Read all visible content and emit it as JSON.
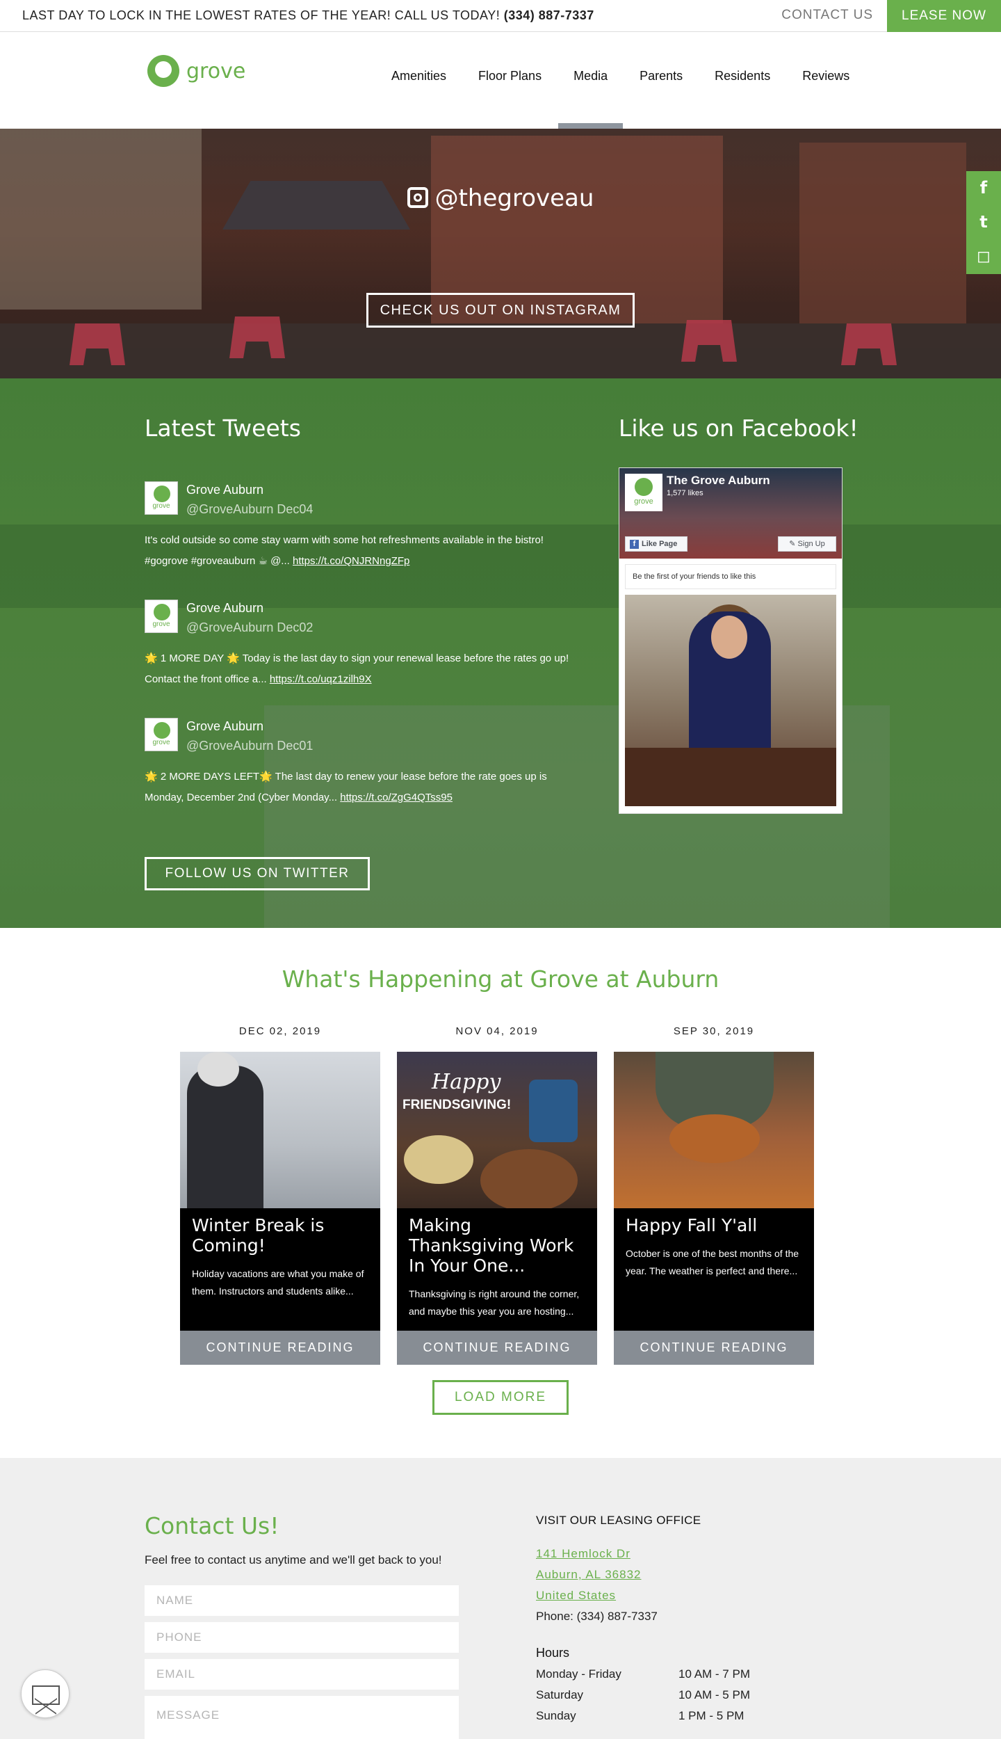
{
  "topbar": {
    "promo": "LAST DAY TO LOCK IN THE LOWEST RATES OF THE YEAR! CALL US TODAY!",
    "phone": "(334) 887-7337",
    "contact_label": "CONTACT US",
    "lease_label": "LEASE NOW"
  },
  "header": {
    "logo_text": "grove",
    "nav": [
      "Amenities",
      "Floor Plans",
      "Media",
      "Parents",
      "Residents",
      "Reviews"
    ],
    "active_nav": "Media"
  },
  "hero": {
    "instagram_handle": "@thegroveau",
    "instagram_button": "CHECK US OUT ON INSTAGRAM"
  },
  "social_rail": {
    "icons": [
      "facebook-icon",
      "twitter-icon",
      "instagram-icon"
    ],
    "glyphs": [
      "f",
      "t",
      "◻"
    ]
  },
  "tweets": {
    "heading": "Latest Tweets",
    "items": [
      {
        "name": "Grove Auburn",
        "handle": "@GroveAuburn Dec04",
        "text": "It's cold outside so come stay warm with some hot refreshments available in the bistro!",
        "text2": "#gogrove #groveauburn ☕ @...",
        "link": "https://t.co/QNJRNngZFp"
      },
      {
        "name": "Grove Auburn",
        "handle": "@GroveAuburn Dec02",
        "text": "🌟 1 MORE DAY 🌟 Today is the last day to sign your renewal lease before the rates go up!",
        "text2": "Contact the front office a...",
        "link": "https://t.co/uqz1zilh9X"
      },
      {
        "name": "Grove Auburn",
        "handle": "@GroveAuburn Dec01",
        "text": "🌟 2 MORE DAYS LEFT🌟 The last day to renew your lease before the rate goes up is",
        "text2": "Monday, December 2nd (Cyber Monday...",
        "link": "https://t.co/ZgG4QTss95"
      }
    ],
    "follow_button": "FOLLOW US ON TWITTER"
  },
  "facebook": {
    "heading": "Like us on Facebook!",
    "page_name": "The Grove Auburn",
    "likes": "1,577 likes",
    "like_button": "Like Page",
    "signup_button": "✎ Sign Up",
    "friends_text": "Be the first of your friends to like this",
    "logo_text": "grove"
  },
  "blog": {
    "title": "What's Happening at Grove at Auburn",
    "posts": [
      {
        "date": "DEC 02, 2019",
        "title": "Winter Break is Coming!",
        "excerpt": "Holiday vacations are what you make of them. Instructors and students alike...",
        "cta": "CONTINUE READING"
      },
      {
        "date": "NOV 04, 2019",
        "title": "Making Thanksgiving Work In Your One...",
        "excerpt": "Thanksgiving is right around the corner, and maybe this year you are hosting...",
        "cta": "CONTINUE READING",
        "image_text_1": "Happy",
        "image_text_2": "FRIENDSGIVING!"
      },
      {
        "date": "SEP 30, 2019",
        "title": "Happy Fall Y'all",
        "excerpt": "October is one of the best months of the year. The weather is perfect and there...",
        "cta": "CONTINUE READING"
      }
    ],
    "load_more": "LOAD MORE"
  },
  "contact": {
    "title": "Contact Us!",
    "description": "Feel free to contact us anytime and we'll get back to you!",
    "placeholders": {
      "name": "NAME",
      "phone": "PHONE",
      "email": "EMAIL",
      "message": "MESSAGE"
    },
    "office_title": "VISIT OUR LEASING OFFICE",
    "address_1": "141 Hemlock Dr",
    "address_2": "Auburn, AL 36832",
    "address_3": "United States",
    "phone_line": "Phone: (334) 887-7337",
    "hours_title": "Hours",
    "hours": [
      {
        "days": "Monday - Friday",
        "time": "10 AM - 7 PM"
      },
      {
        "days": "Saturday",
        "time": "10 AM - 5 PM"
      },
      {
        "days": "Sunday",
        "time": "1 PM - 5 PM"
      }
    ]
  },
  "colors": {
    "brand_green": "#6ab04c",
    "button_gray": "#878d94"
  }
}
